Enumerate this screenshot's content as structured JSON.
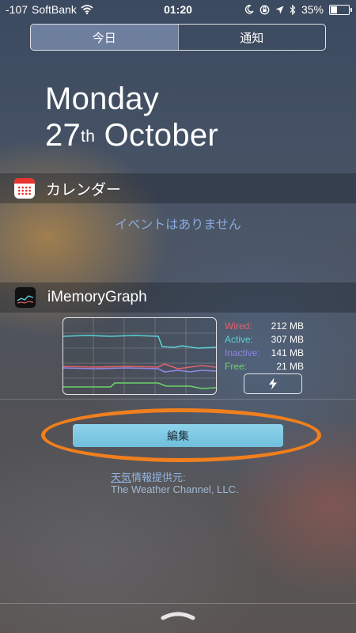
{
  "status_bar": {
    "signal": "-107",
    "carrier": "SoftBank",
    "time": "01:20",
    "battery": "35%",
    "icons": [
      "wifi-icon",
      "moon-icon",
      "orientation-lock-icon",
      "location-icon",
      "bluetooth-icon",
      "battery-icon"
    ]
  },
  "tabs": [
    {
      "label": "今日",
      "active": true
    },
    {
      "label": "通知",
      "active": false
    }
  ],
  "date": {
    "weekday": "Monday",
    "day": "27",
    "suffix": "th",
    "month": "October"
  },
  "calendar_widget": {
    "title": "カレンダー",
    "empty_text": "イベントはありません"
  },
  "memory_widget": {
    "title": "iMemoryGraph",
    "legend": [
      {
        "label": "Wired:",
        "value": "212 MB",
        "color": "#e0606a"
      },
      {
        "label": "Active:",
        "value": "307 MB",
        "color": "#5ad0d6"
      },
      {
        "label": "Inactive:",
        "value": "141 MB",
        "color": "#8f86e0"
      },
      {
        "label": "Free:",
        "value": "21 MB",
        "color": "#6ad36a"
      }
    ],
    "action_icon": "lightning-icon"
  },
  "edit_button": {
    "label": "編集"
  },
  "attribution": {
    "link_text": "天気",
    "line1_rest": "情報提供元:",
    "line2": "The Weather Channel, LLC."
  },
  "annotation_color": "#f07f1e"
}
